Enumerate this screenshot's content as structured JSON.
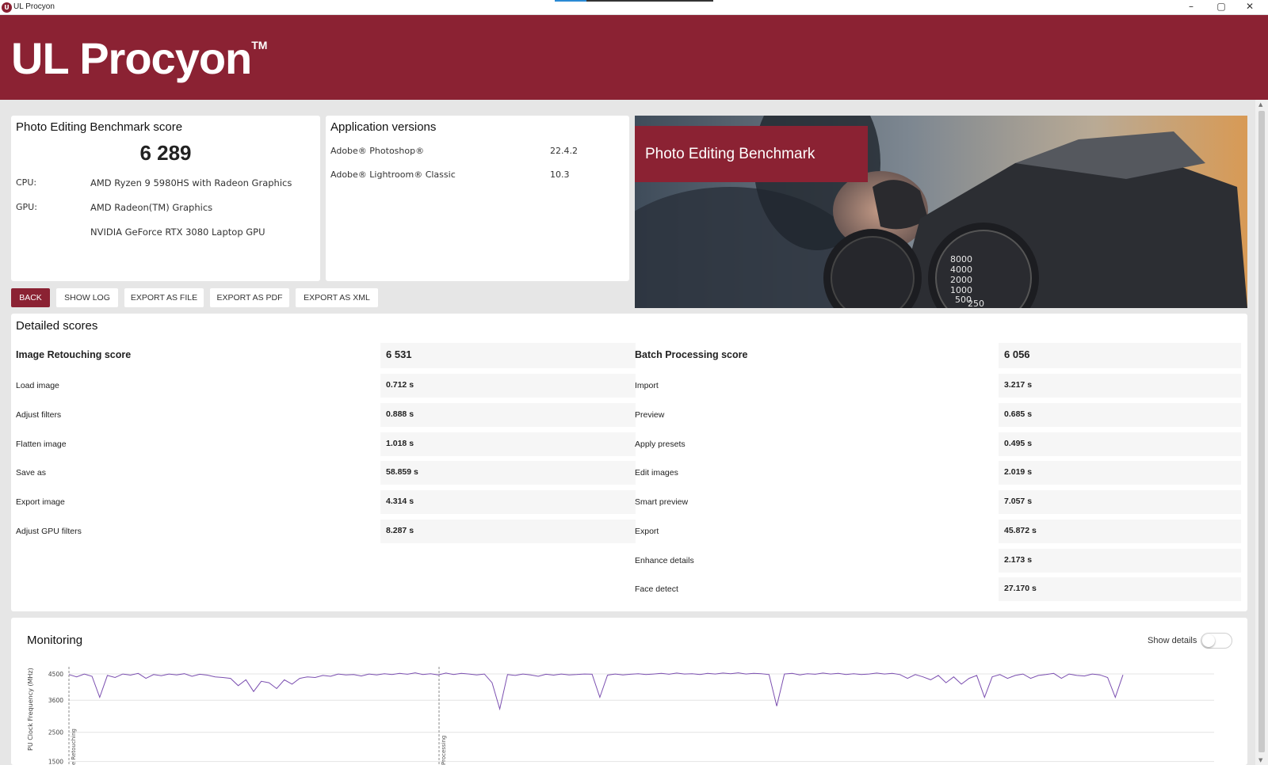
{
  "window": {
    "title": "UL Procyon",
    "controls": {
      "minimize": "–",
      "maximize": "▢",
      "close": "✕"
    }
  },
  "header": {
    "brand": "UL Procyon",
    "trademark": "TM"
  },
  "score_card": {
    "title": "Photo Editing Benchmark score",
    "score": "6 289",
    "cpu_label": "CPU:",
    "cpu_value": "AMD Ryzen 9 5980HS with Radeon Graphics",
    "gpu_label": "GPU:",
    "gpu_values": [
      "AMD Radeon(TM) Graphics",
      "NVIDIA GeForce RTX 3080 Laptop GPU"
    ]
  },
  "versions_card": {
    "title": "Application versions",
    "apps": [
      {
        "name": "Adobe® Photoshop®",
        "version": "22.4.2"
      },
      {
        "name": "Adobe® Lightroom® Classic",
        "version": "10.3"
      }
    ]
  },
  "hero": {
    "label": "Photo Editing Benchmark",
    "dial_numbers": [
      "8000",
      "4000",
      "2000",
      "1000",
      "500",
      "250"
    ]
  },
  "toolbar": {
    "back": "BACK",
    "show_log": "SHOW LOG",
    "export_file": "EXPORT AS FILE",
    "export_pdf": "EXPORT AS PDF",
    "export_xml": "EXPORT AS XML"
  },
  "detailed": {
    "title": "Detailed scores",
    "image_retouching": {
      "label": "Image Retouching score",
      "score": "6 531",
      "rows": [
        {
          "label": "Load image",
          "value": "0.712 s"
        },
        {
          "label": "Adjust filters",
          "value": "0.888 s"
        },
        {
          "label": "Flatten image",
          "value": "1.018 s"
        },
        {
          "label": "Save as",
          "value": "58.859 s"
        },
        {
          "label": "Export image",
          "value": "4.314 s"
        },
        {
          "label": "Adjust GPU filters",
          "value": "8.287 s"
        }
      ]
    },
    "batch_processing": {
      "label": "Batch Processing score",
      "score": "6 056",
      "rows": [
        {
          "label": "Import",
          "value": "3.217 s"
        },
        {
          "label": "Preview",
          "value": "0.685 s"
        },
        {
          "label": "Apply presets",
          "value": "0.495 s"
        },
        {
          "label": "Edit images",
          "value": "2.019 s"
        },
        {
          "label": "Smart preview",
          "value": "7.057 s"
        },
        {
          "label": "Export",
          "value": "45.872 s"
        },
        {
          "label": "Enhance details",
          "value": "2.173 s"
        },
        {
          "label": "Face detect",
          "value": "27.170 s"
        }
      ]
    }
  },
  "monitoring": {
    "title": "Monitoring",
    "show_details_label": "Show details",
    "show_details_on": false,
    "colors": {
      "line": "#7b4fb0",
      "grid": "#e4e4e4"
    }
  },
  "chart_data": {
    "type": "line",
    "ylabel": "PU Clock Frequency (MHz)",
    "yticks": [
      4500,
      3600,
      2500,
      1500
    ],
    "markers": [
      "e Retouching",
      "Processing"
    ],
    "series": [
      {
        "values": [
          4480,
          4400,
          4500,
          4420,
          3700,
          4450,
          4380,
          4500,
          4460,
          4520,
          4350,
          4480,
          4440,
          4500,
          4470,
          4510,
          4420,
          4490,
          4460,
          4400,
          4380,
          4350,
          4100,
          4300,
          3900,
          4250,
          4200,
          4000,
          4300,
          4150,
          4350,
          4400,
          4380,
          4450,
          4420,
          4500,
          4470,
          4480,
          4430,
          4500,
          4470,
          4510,
          4480,
          4520,
          4490,
          4540,
          4480,
          4510,
          4470,
          4530,
          4480,
          4520,
          4500,
          4470,
          4500,
          4200,
          3300,
          4480,
          4450,
          4500,
          4470,
          4420,
          4490,
          4460,
          4500,
          4470,
          4480,
          4500,
          4490,
          3700,
          4460,
          4500,
          4470,
          4490,
          4510,
          4480,
          4500,
          4520,
          4490,
          4530,
          4500,
          4510,
          4480,
          4520,
          4500,
          4530,
          4510,
          4540,
          4500,
          4520,
          4510,
          4480,
          3400,
          4500,
          4520,
          4470,
          4510,
          4490,
          4530,
          4500,
          4520,
          4480,
          4510,
          4480,
          4500,
          4530,
          4500,
          4520,
          4480,
          4350,
          4480,
          4400,
          4300,
          4450,
          4200,
          4400,
          4150,
          4350,
          4450,
          3700,
          4400,
          4480,
          4350,
          4450,
          4500,
          4350,
          4450,
          4480,
          4520,
          4350,
          4500,
          4450,
          4430,
          4500,
          4470,
          4380,
          3700,
          4470
        ]
      }
    ],
    "ylim": [
      1000,
      4800
    ]
  }
}
